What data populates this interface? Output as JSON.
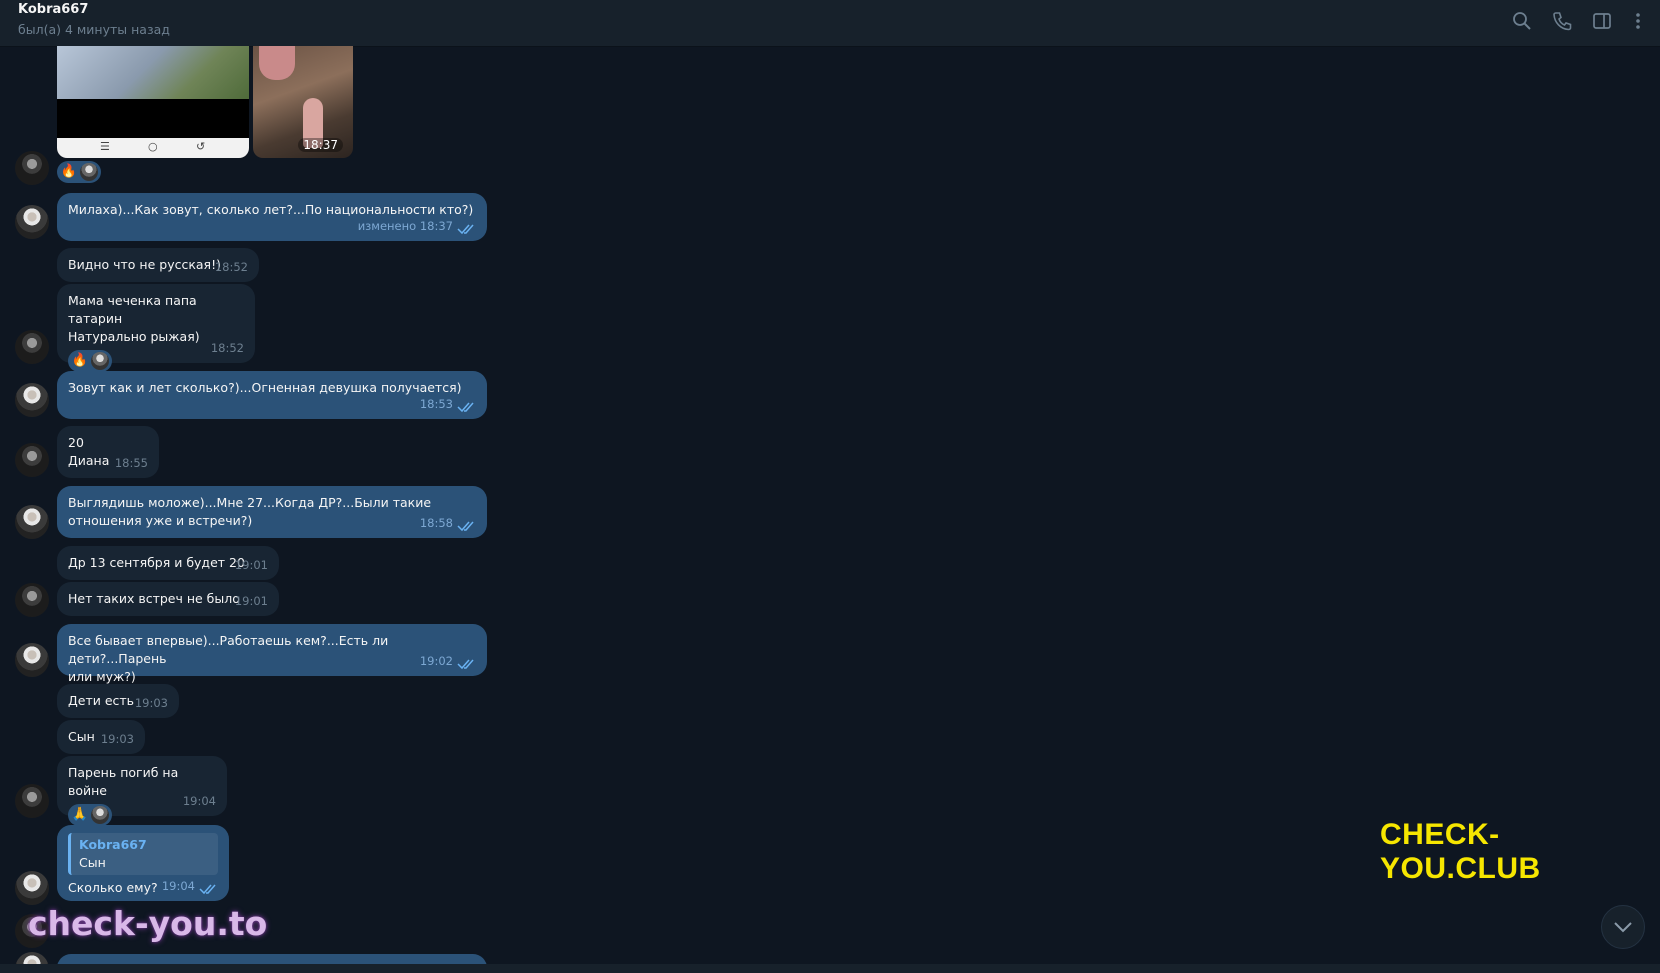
{
  "header": {
    "name": "Kobra667",
    "status": "был(а) 4 минуты назад",
    "icons": [
      "search-icon",
      "phone-icon",
      "sidebar-icon",
      "more-icon"
    ]
  },
  "media": {
    "time": "18:37",
    "nav_glyphs": [
      "☰",
      "○",
      "↺"
    ]
  },
  "messages": [
    {
      "side": "in",
      "type": "media",
      "time": "18:37",
      "reactions": [
        "🔥",
        "avatar"
      ]
    },
    {
      "side": "out",
      "text": "Милаха)...Как зовут, сколько лет?...По национальности кто?)",
      "time": "изменено 18:37"
    },
    {
      "side": "in",
      "text": "Видно что не русская!)",
      "time": "18:52"
    },
    {
      "side": "in",
      "lines": [
        "Мама чеченка папа татарин",
        "Натурально рыжая)"
      ],
      "time": "18:52",
      "reactions": [
        "🔥",
        "avatar"
      ]
    },
    {
      "side": "out",
      "text": "Зовут как и лет сколько?)...Огненная девушка получается)",
      "time": "18:53"
    },
    {
      "side": "in",
      "lines": [
        "20",
        "Диана"
      ],
      "time": "18:55"
    },
    {
      "side": "out",
      "lines": [
        "Выглядишь моложе)...Мне 27...Когда ДР?...Были такие",
        "отношения уже и встречи?)"
      ],
      "time": "18:58"
    },
    {
      "side": "in",
      "text": "Др 13 сентября и будет 20",
      "time": "19:01"
    },
    {
      "side": "in",
      "text": "Нет таких встреч не было",
      "time": "19:01"
    },
    {
      "side": "out",
      "lines": [
        "Все бывает впервые)...Работаешь кем?...Есть ли дети?...Парень",
        "или муж?)"
      ],
      "time": "19:02"
    },
    {
      "side": "in",
      "text": "Дети есть",
      "time": "19:03"
    },
    {
      "side": "in",
      "text": "Сын",
      "time": "19:03"
    },
    {
      "side": "in",
      "text": "Парень погиб на войне",
      "time": "19:04",
      "reactions": [
        "🙏",
        "avatar"
      ]
    },
    {
      "side": "out",
      "reply_to": {
        "name": "Kobra667",
        "text": "Сын"
      },
      "text": "Сколько ему?",
      "time": "19:04"
    }
  ],
  "watermarks": {
    "top_right": "CHECK-YOU.CLUB",
    "bottom_left": "check-you.to"
  },
  "colors": {
    "background": "#0e1621",
    "header": "#17212b",
    "incoming": "#182533",
    "outgoing": "#2b5278",
    "accent": "#6ab2f2",
    "watermark_yellow": "#f6e600"
  }
}
